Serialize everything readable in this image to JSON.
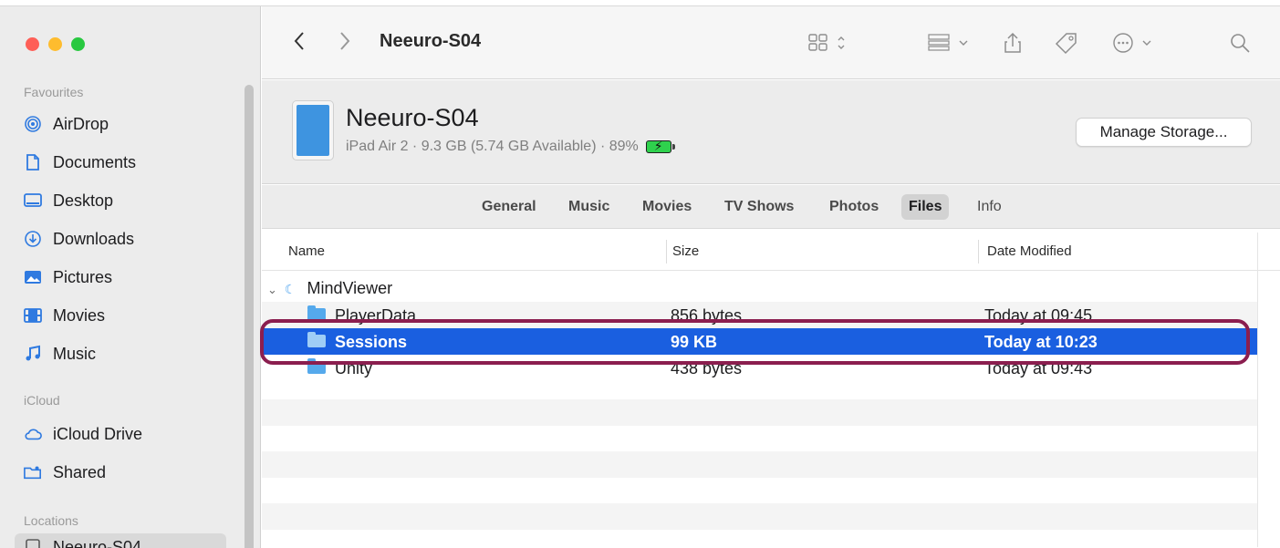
{
  "sidebar": {
    "sections": {
      "favourites": "Favourites",
      "icloud": "iCloud",
      "locations": "Locations"
    },
    "favourites": [
      {
        "label": "AirDrop",
        "icon": "airdrop-icon"
      },
      {
        "label": "Documents",
        "icon": "document-icon"
      },
      {
        "label": "Desktop",
        "icon": "desktop-icon"
      },
      {
        "label": "Downloads",
        "icon": "download-icon"
      },
      {
        "label": "Pictures",
        "icon": "pictures-icon"
      },
      {
        "label": "Movies",
        "icon": "movies-icon"
      },
      {
        "label": "Music",
        "icon": "music-icon"
      }
    ],
    "icloud": [
      {
        "label": "iCloud Drive",
        "icon": "cloud-icon"
      },
      {
        "label": "Shared",
        "icon": "shared-folder-icon"
      }
    ],
    "locations": [
      {
        "label": "Neeuro-S04",
        "icon": "ipad-icon"
      }
    ]
  },
  "toolbar": {
    "title": "Neeuro-S04"
  },
  "device": {
    "name": "Neeuro-S04",
    "info": "iPad Air 2 · 9.3 GB (5.74 GB Available) · 89%",
    "battery_percent": 89,
    "manage_label": "Manage Storage..."
  },
  "tabs": [
    "General",
    "Music",
    "Movies",
    "TV Shows",
    "Photos",
    "Files",
    "Info"
  ],
  "active_tab": "Files",
  "columns": {
    "name": "Name",
    "size": "Size",
    "date": "Date Modified"
  },
  "files": {
    "app": "MindViewer",
    "items": [
      {
        "name": "PlayerData",
        "size": "856 bytes",
        "date": "Today at 09:45"
      },
      {
        "name": "Sessions",
        "size": "99 KB",
        "date": "Today at 10:23",
        "selected": true
      },
      {
        "name": "Unity",
        "size": "438 bytes",
        "date": "Today at 09:43"
      }
    ]
  },
  "colors": {
    "selection": "#1a5fe0",
    "highlight_ring": "#8b1e4f",
    "folder": "#55a9ec"
  }
}
